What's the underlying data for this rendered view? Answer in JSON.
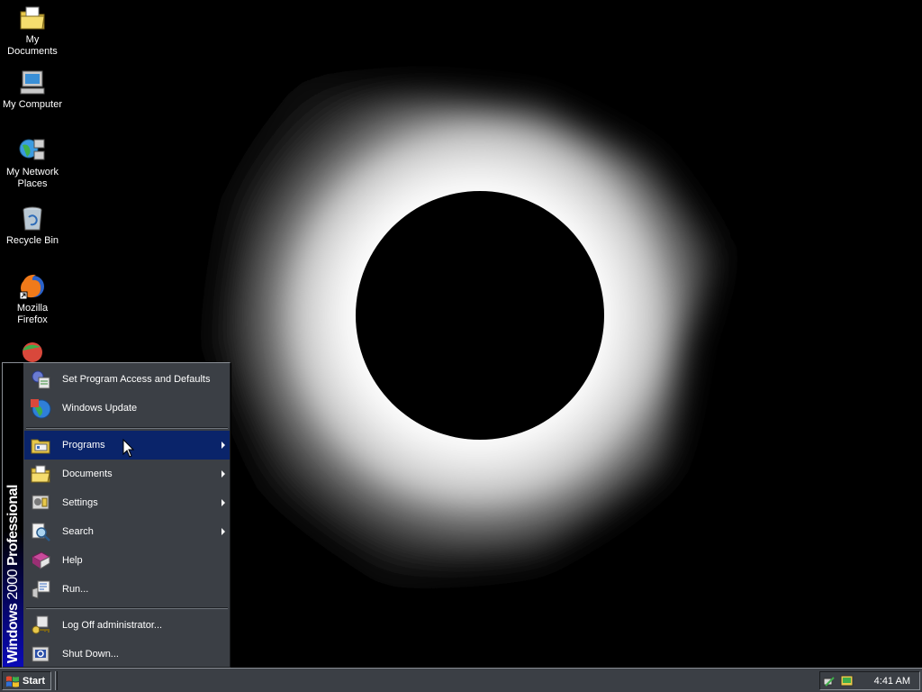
{
  "desktop": {
    "icons": [
      {
        "label": "My Documents",
        "icon": "folder-documents-icon"
      },
      {
        "label": "My Computer",
        "icon": "computer-icon"
      },
      {
        "label": "My Network Places",
        "icon": "network-places-icon"
      },
      {
        "label": "Recycle Bin",
        "icon": "recycle-bin-icon"
      },
      {
        "label": "Mozilla Firefox",
        "icon": "firefox-icon"
      }
    ]
  },
  "start_menu": {
    "banner": {
      "bold": "Windows",
      "light": "2000",
      "edition": " Professional"
    },
    "items": [
      {
        "label": "Set Program Access and Defaults",
        "icon": "program-access-icon",
        "submenu": false
      },
      {
        "label": "Windows Update",
        "icon": "windows-update-icon",
        "submenu": false
      },
      {
        "label": "Programs",
        "icon": "programs-icon",
        "submenu": true,
        "highlighted": true
      },
      {
        "label": "Documents",
        "icon": "documents-folder-icon",
        "submenu": true
      },
      {
        "label": "Settings",
        "icon": "settings-icon",
        "submenu": true
      },
      {
        "label": "Search",
        "icon": "search-icon",
        "submenu": true
      },
      {
        "label": "Help",
        "icon": "help-book-icon",
        "submenu": false
      },
      {
        "label": "Run...",
        "icon": "run-icon",
        "submenu": false
      },
      {
        "label": "Log Off administrator...",
        "icon": "log-off-key-icon",
        "submenu": false
      },
      {
        "label": "Shut Down...",
        "icon": "shut-down-icon",
        "submenu": false
      }
    ]
  },
  "taskbar": {
    "start_label": "Start",
    "clock": "4:41 AM"
  },
  "colors": {
    "taskbar_bg": "#3b3f45",
    "highlight": "#0a246a",
    "banner_blue": "#0a0ab8"
  }
}
